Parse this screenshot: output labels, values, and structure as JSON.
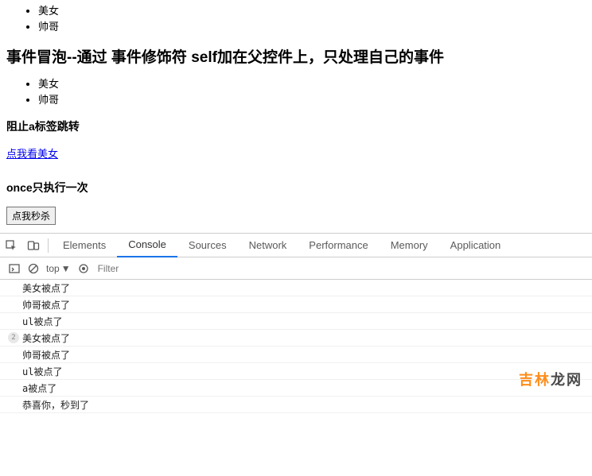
{
  "page": {
    "list1": [
      "美女",
      "帅哥"
    ],
    "heading1": "事件冒泡--通过 事件修饰符 self加在父控件上，只处理自己的事件",
    "list2": [
      "美女",
      "帅哥"
    ],
    "heading2": "阻止a标签跳转",
    "link_text": "点我看美女",
    "heading3": "once只执行一次",
    "button_text": "点我秒杀"
  },
  "devtools": {
    "tabs": {
      "elements": "Elements",
      "console": "Console",
      "sources": "Sources",
      "network": "Network",
      "performance": "Performance",
      "memory": "Memory",
      "application": "Application"
    },
    "toolbar": {
      "context": "top",
      "filter_placeholder": "Filter"
    },
    "console": [
      {
        "count": null,
        "text": "美女被点了"
      },
      {
        "count": null,
        "text": "帅哥被点了"
      },
      {
        "count": null,
        "text": "ul被点了"
      },
      {
        "count": "2",
        "text": "美女被点了"
      },
      {
        "count": null,
        "text": "帅哥被点了"
      },
      {
        "count": null,
        "text": "ul被点了"
      },
      {
        "count": null,
        "text": "a被点了"
      },
      {
        "count": null,
        "text": "恭喜你，秒到了"
      }
    ]
  },
  "watermark": {
    "a": "吉林",
    "b": "龙网"
  }
}
